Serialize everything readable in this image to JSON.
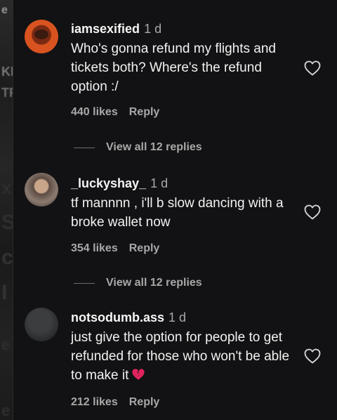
{
  "background": {
    "fragments": [
      "e",
      "KE",
      "TR",
      "x",
      "S",
      "c",
      "I",
      "e",
      "e"
    ]
  },
  "comments": [
    {
      "username": "iamsexified",
      "time": "1 d",
      "text": "Who's gonna refund my flights and tickets both? Where's the refund option :/",
      "likes": "440 likes",
      "reply": "Reply",
      "view_replies": "View all 12 replies"
    },
    {
      "username": "_luckyshay_",
      "time": "1 d",
      "text": "tf mannnn , i'll b slow dancing with a broke wallet now",
      "likes": "354 likes",
      "reply": "Reply",
      "view_replies": "View all 12 replies"
    },
    {
      "username": "notsodumb.ass",
      "time": "1 d",
      "text": "just give the option for people to get refunded for those who won't be able to make it",
      "likes": "212 likes",
      "reply": "Reply"
    }
  ],
  "icons": {
    "like": "heart-outline-icon",
    "broken_heart_emoji": "broken-heart-icon"
  },
  "colors": {
    "background": "#121214",
    "secondary_text": "#a8a8a8",
    "broken_heart": "#e0245e"
  }
}
